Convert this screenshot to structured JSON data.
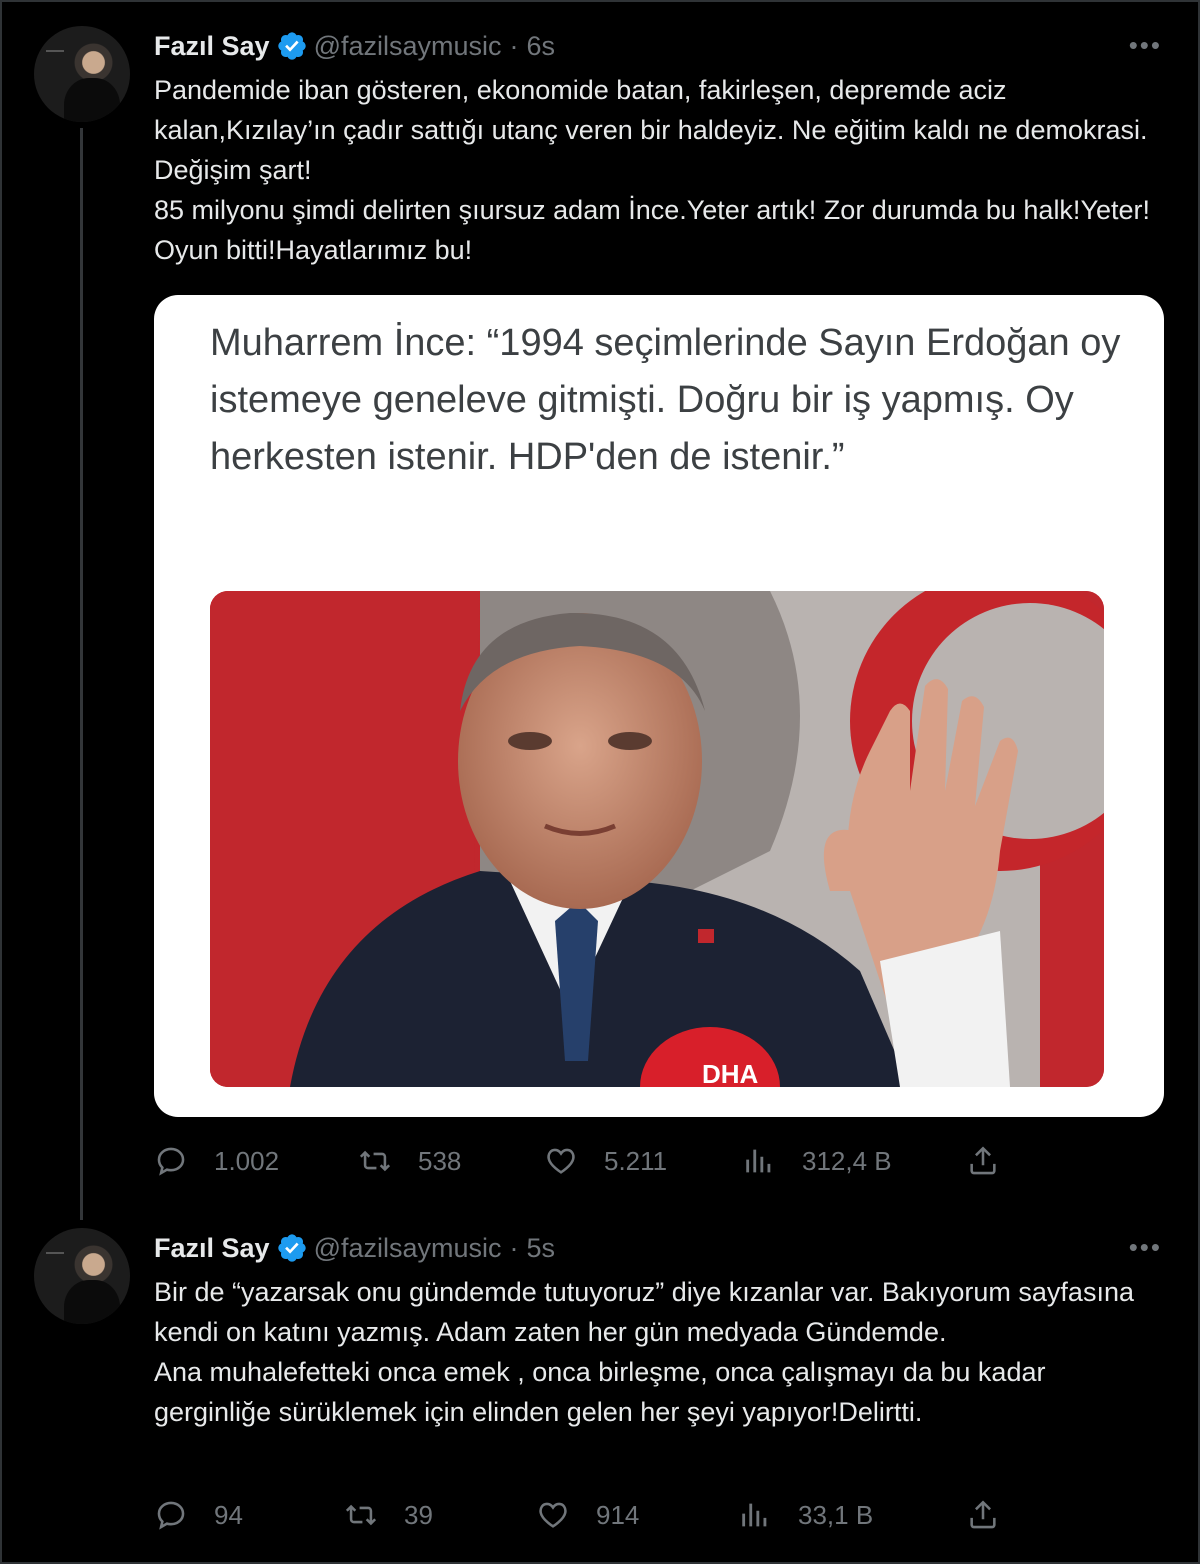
{
  "thread": {
    "tweets": [
      {
        "author": {
          "name": "Fazıl Say",
          "handle": "@fazilsaymusic",
          "verified": true
        },
        "time": "6s",
        "text_lines": [
          "Pandemide iban gösteren, ekonomide batan, fakirleşen, depremde aciz kalan,Kızılay’ın çadır sattığı utanç veren bir haldeyiz. Ne eğitim kaldı ne demokrasi. Değişim şart!",
          "85 milyonu şimdi delirten şıursuz adam İnce.Yeter artık! Zor durumda bu halk!Yeter! Oyun bitti!Hayatlarımız bu!"
        ],
        "media_card": {
          "quote": "Muharrem İnce: “1994 seçimlerinde Sayın Erdoğan oy istemeye geneleve gitmişti. Doğru bir iş yapmış. Oy herkesten istenir. HDP'den de istenir.”",
          "photo_label": "DHA"
        },
        "stats": {
          "replies": "1.002",
          "retweets": "538",
          "likes": "5.211",
          "views": "312,4 B"
        }
      },
      {
        "author": {
          "name": "Fazıl Say",
          "handle": "@fazilsaymusic",
          "verified": true
        },
        "time": "5s",
        "text_lines": [
          "Bir de “yazarsak onu gündemde tutuyoruz” diye kızanlar var. Bakıyorum sayfasına kendi on katını yazmış. Adam zaten her gün medyada Gündemde.",
          "Ana muhalefetteki onca emek , onca birleşme, onca çalışmayı da bu kadar gerginliğe sürüklemek için elinden gelen her şeyi yapıyor!Delirtti."
        ],
        "stats": {
          "replies": "94",
          "retweets": "39",
          "likes": "914",
          "views": "33,1 B"
        }
      }
    ],
    "more_label": "•••",
    "separator": "·"
  },
  "colors": {
    "background": "#000000",
    "text": "#e7e9ea",
    "muted": "#71767b",
    "verified": "#1d9bf0"
  },
  "icons": [
    "reply-icon",
    "retweet-icon",
    "like-icon",
    "views-icon",
    "share-icon",
    "verified-badge-icon",
    "more-icon"
  ]
}
